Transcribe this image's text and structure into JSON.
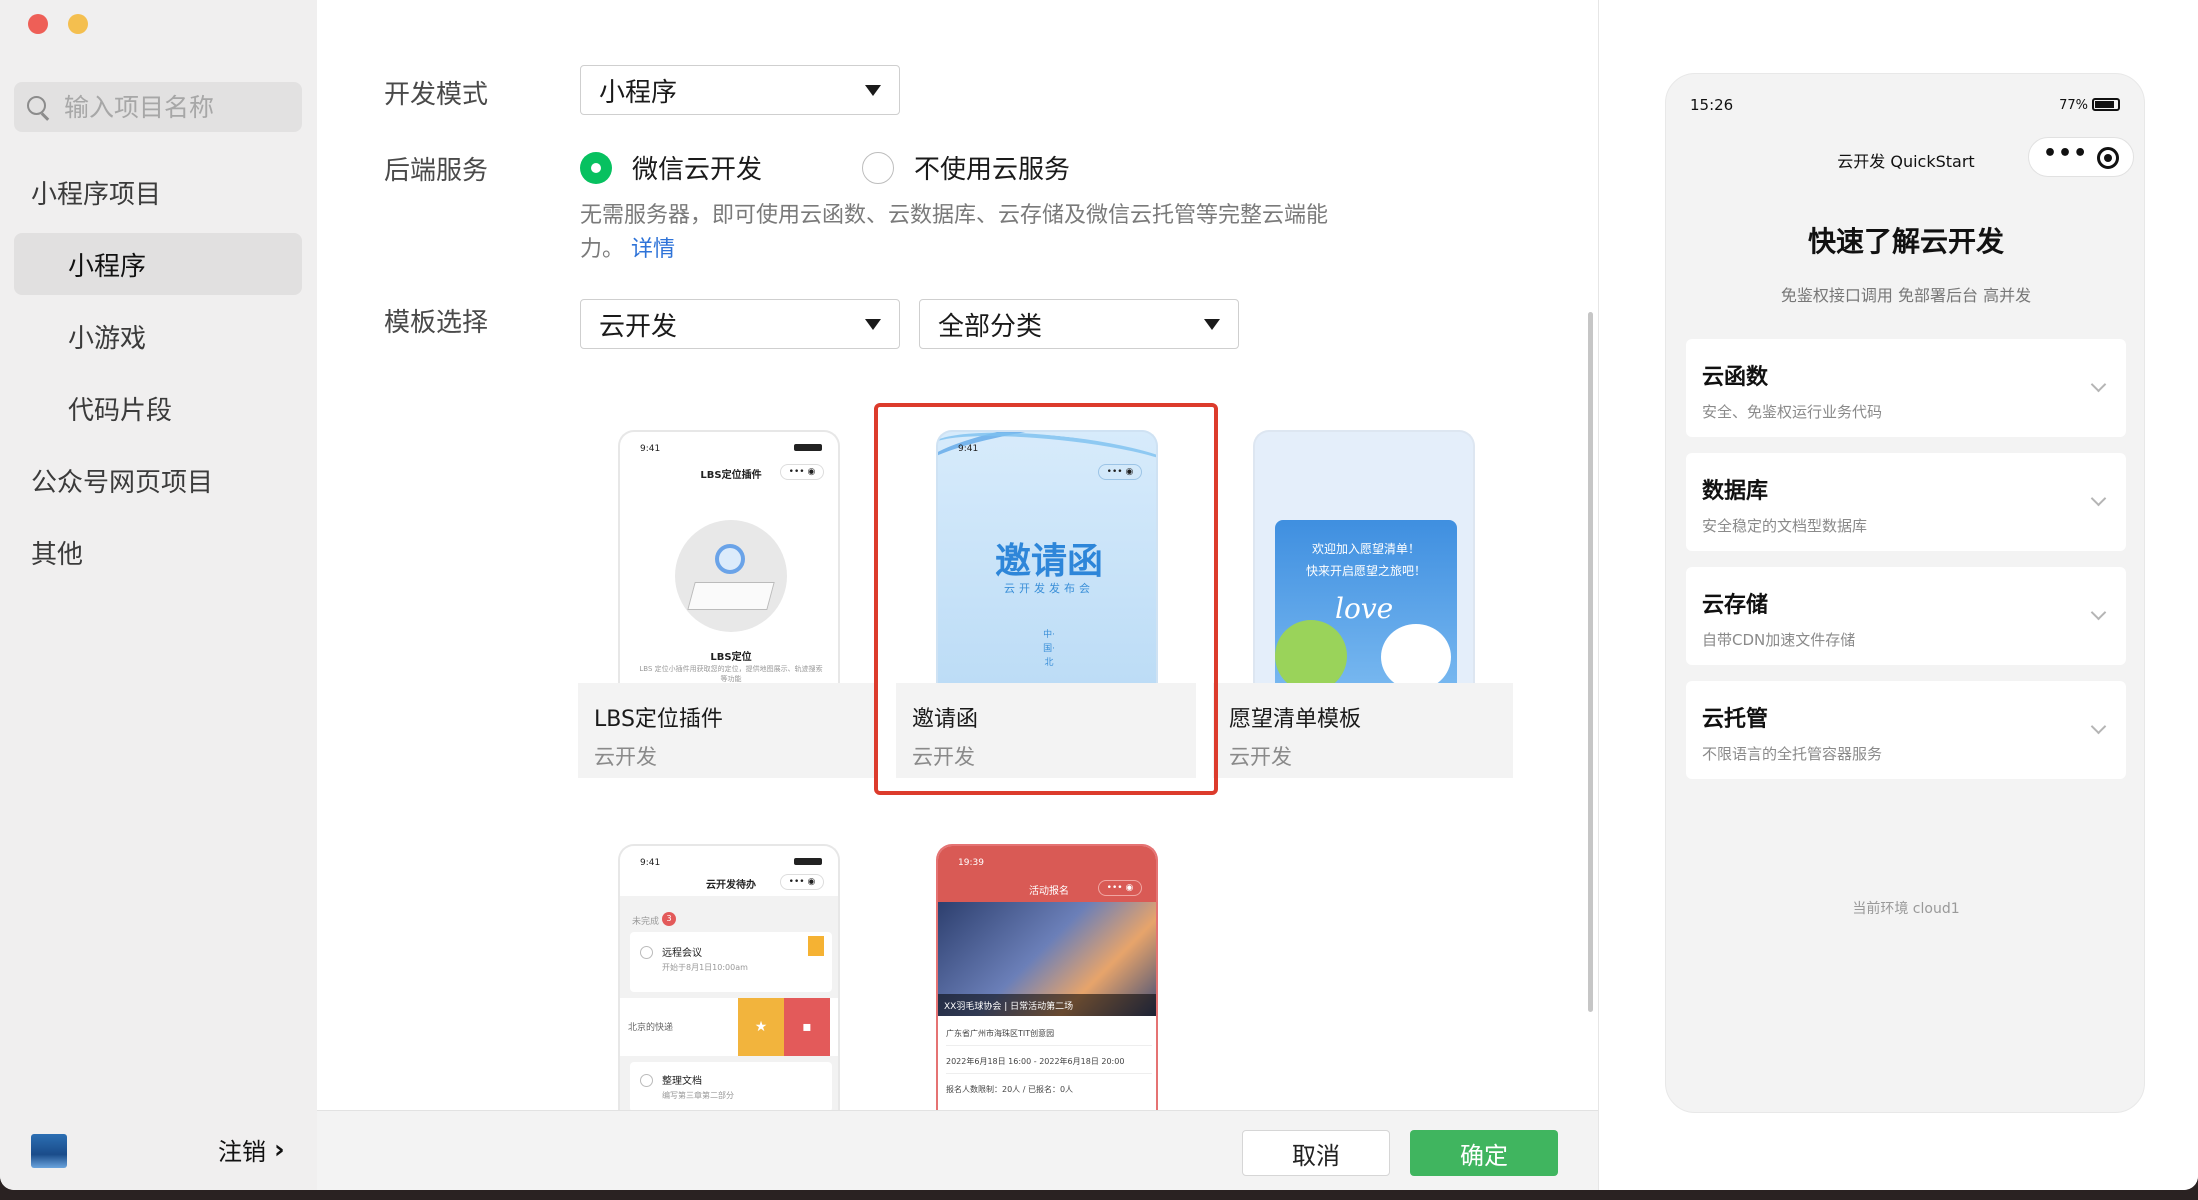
{
  "sidebar": {
    "search_placeholder": "输入项目名称",
    "groups": [
      {
        "label": "小程序项目"
      },
      {
        "label": "公众号网页项目"
      },
      {
        "label": "其他"
      }
    ],
    "subitems": [
      {
        "label": "小程序",
        "active": true
      },
      {
        "label": "小游戏"
      },
      {
        "label": "代码片段"
      }
    ],
    "logout_label": "注销",
    "logout_arrow": "›"
  },
  "form": {
    "dev_mode_label": "开发模式",
    "dev_mode_value": "小程序",
    "backend_label": "后端服务",
    "backend_options": [
      {
        "label": "微信云开发",
        "selected": true
      },
      {
        "label": "不使用云服务",
        "selected": false
      }
    ],
    "backend_desc": "无需服务器，即可使用云函数、云数据库、云存储及微信云托管等完整云端能力。",
    "backend_desc_link": "详情",
    "template_label": "模板选择",
    "template_type_value": "云开发",
    "template_category_value": "全部分类"
  },
  "templates": [
    {
      "title": "LBS定位插件",
      "subtitle": "云开发",
      "phone_title": "LBS定位插件",
      "phone_time": "9:41",
      "phone_caption": "LBS定位",
      "phone_desc": "LBS 定位小插件用获取您的定位，提供地图展示、轨迹搜索等功能"
    },
    {
      "title": "邀请函",
      "subtitle": "云开发",
      "phone_time": "9:41",
      "phone_heading": "邀请函",
      "phone_sub": "云开发发布会",
      "phone_vertical": "中·国·北",
      "selected": true
    },
    {
      "title": "愿望清单模板",
      "subtitle": "云开发",
      "phone_banner_line1": "欢迎加入愿望清单！",
      "phone_banner_line2": "快来开启愿望之旅吧！",
      "phone_script": "love"
    },
    {
      "phone_title": "云开发待办",
      "phone_time": "9:41",
      "phone_section": "未完成",
      "phone_badge": "3",
      "phone_todo1": "远程会议",
      "phone_todo1_sub": "开始于8月1日10:00am",
      "phone_todo_partial": "北京的快递",
      "phone_todo2": "整理文档",
      "phone_todo2_sub": "编写第三章第二部分"
    },
    {
      "phone_title": "活动报名",
      "phone_time": "19:39",
      "phone_photo_caption": "XX羽毛球协会 | 日常活动第二场",
      "phone_line1": "广东省广州市海珠区TIT创意园",
      "phone_line2": "2022年6月18日 16:00 - 2022年6月18日 20:00",
      "phone_line3": "报名人数限制：20人 / 已报名：0人"
    }
  ],
  "footer": {
    "cancel_label": "取消",
    "ok_label": "确定"
  },
  "preview": {
    "time": "15:26",
    "battery": "77%",
    "nav_title": "云开发 QuickStart",
    "capsule_dots": "•••",
    "heading": "快速了解云开发",
    "subheading": "免鉴权接口调用 免部署后台 高并发",
    "items": [
      {
        "title": "云函数",
        "desc": "安全、免鉴权运行业务代码"
      },
      {
        "title": "数据库",
        "desc": "安全稳定的文档型数据库"
      },
      {
        "title": "云存储",
        "desc": "自带CDN加速文件存储"
      },
      {
        "title": "云托管",
        "desc": "不限语言的全托管容器服务"
      }
    ],
    "env_text": "当前环境 cloud1"
  },
  "colors": {
    "accent_green": "#07c160",
    "confirm_green": "#40b55f",
    "selection_red": "#dc3b2c",
    "link_blue": "#2e73d8"
  }
}
